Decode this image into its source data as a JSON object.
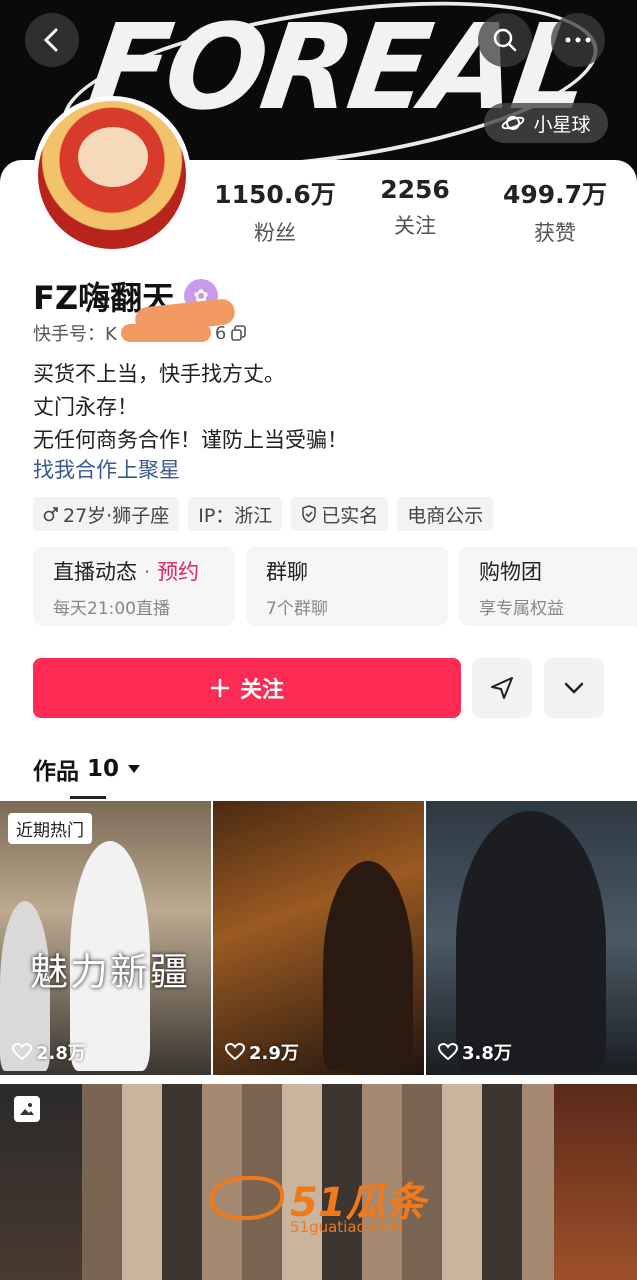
{
  "banner": {
    "text": "FOREAL",
    "planet_label": "小星球"
  },
  "profile": {
    "name": "FZ嗨翻天",
    "uid_prefix": "快手号：K",
    "uid_suffix": "6",
    "bio": [
      "买货不上当，快手找方丈。",
      "丈门永存！",
      "无任何商务合作！谨防上当受骗！"
    ],
    "bio_link": "找我合作上聚星"
  },
  "stats": [
    {
      "value": "1150.6万",
      "label": "粉丝"
    },
    {
      "value": "2256",
      "label": "关注"
    },
    {
      "value": "499.7万",
      "label": "获赞"
    }
  ],
  "tags": [
    {
      "icon": "male-icon",
      "label": "27岁·狮子座"
    },
    {
      "icon": "",
      "label": "IP：浙江"
    },
    {
      "icon": "shield-icon",
      "label": "已实名"
    },
    {
      "icon": "",
      "label": "电商公示"
    }
  ],
  "info_cards": {
    "live": {
      "title": "直播动态",
      "dot": "·",
      "accent": "预约",
      "sub": "每天21:00直播"
    },
    "group": {
      "title": "群聊",
      "sub": "7个群聊"
    },
    "shop": {
      "title": "购物团",
      "sub": "享专属权益"
    }
  },
  "actions": {
    "follow_label": "关注"
  },
  "works": {
    "label": "作品",
    "count": "10"
  },
  "grid": {
    "items": [
      {
        "badge": "近期热门",
        "caption": "魅力新疆",
        "likes": "2.8万"
      },
      {
        "likes": "2.9万"
      },
      {
        "likes": "3.8万"
      }
    ]
  },
  "watermark": {
    "brand": "51瓜条",
    "url": "51guatiao.com"
  },
  "colors": {
    "accent": "#fe2c55",
    "link": "#3a5a8c",
    "verify": "#c99be8"
  }
}
